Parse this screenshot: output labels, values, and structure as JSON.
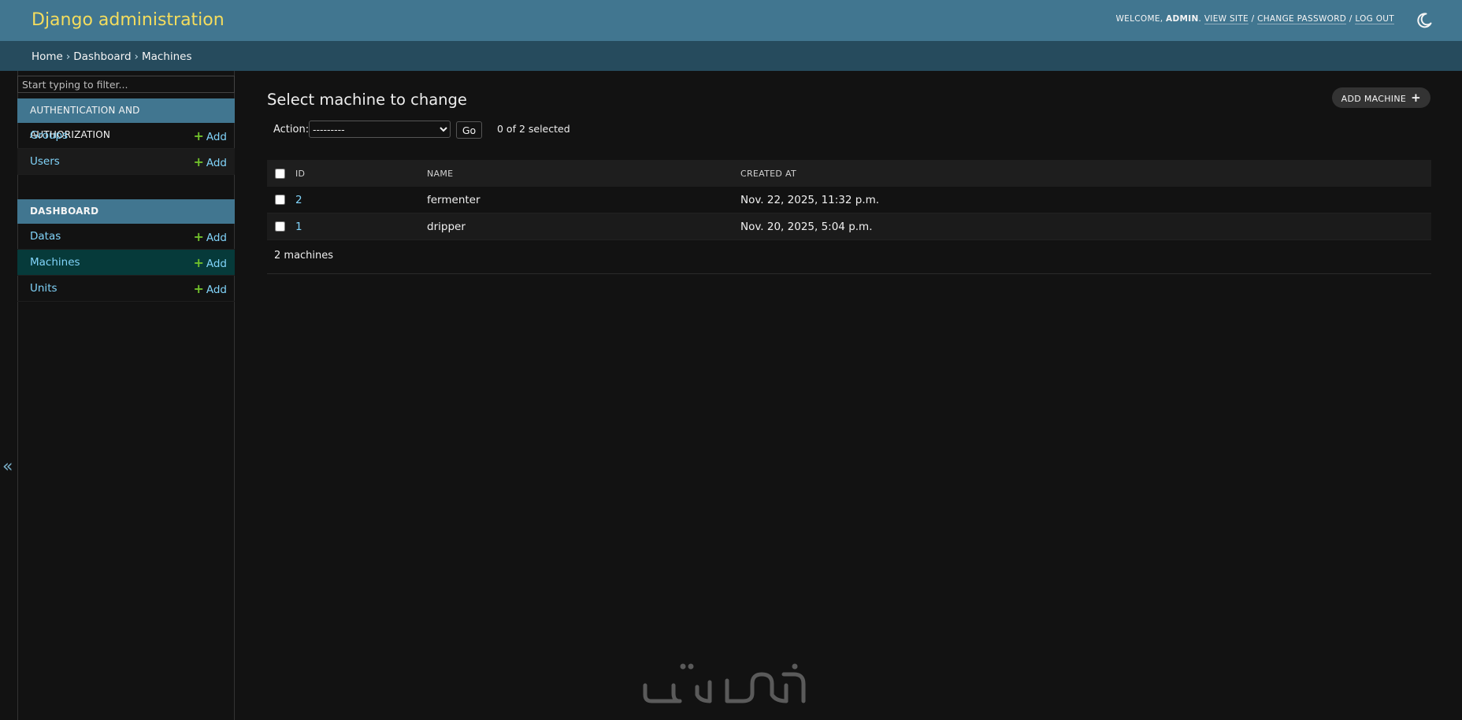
{
  "header": {
    "site_name": "Django administration",
    "welcome": "WELCOME,",
    "username": "ADMIN",
    "view_site": "VIEW SITE",
    "change_password": "CHANGE PASSWORD",
    "log_out": "LOG OUT",
    "separator": "/",
    "theme_icon": "moon-icon"
  },
  "breadcrumbs": {
    "items": [
      "Home",
      "Dashboard",
      "Machines"
    ],
    "separator": "›"
  },
  "sidebar": {
    "filter_placeholder": "Start typing to filter...",
    "collapse_icon": "«",
    "add_label": "Add",
    "modules": [
      {
        "caption": "AUTHENTICATION AND AUTHORIZATION",
        "models": [
          {
            "name": "Groups"
          },
          {
            "name": "Users"
          }
        ]
      },
      {
        "caption": "DASHBOARD",
        "models": [
          {
            "name": "Datas"
          },
          {
            "name": "Machines",
            "selected": true
          },
          {
            "name": "Units"
          }
        ]
      }
    ]
  },
  "content": {
    "title": "Select machine to change",
    "add_button": "ADD MACHINE",
    "action_label": "Action:",
    "action_selected": "---------",
    "go_label": "Go",
    "selected_count": "0 of 2 selected",
    "columns": [
      "ID",
      "NAME",
      "CREATED AT"
    ],
    "rows": [
      {
        "id": "2",
        "name": "fermenter",
        "created_at": "Nov. 22, 2025, 11:32 p.m."
      },
      {
        "id": "1",
        "name": "dripper",
        "created_at": "Nov. 20, 2025, 5:04 p.m."
      }
    ],
    "paginator": "2 machines"
  },
  "colors": {
    "header_bg": "#417690",
    "breadcrumb_bg": "#264b5d",
    "link": "#81d4fa",
    "add_plus": "#70bf2b",
    "site_name": "#f5dd5d",
    "page_bg": "#121212"
  }
}
